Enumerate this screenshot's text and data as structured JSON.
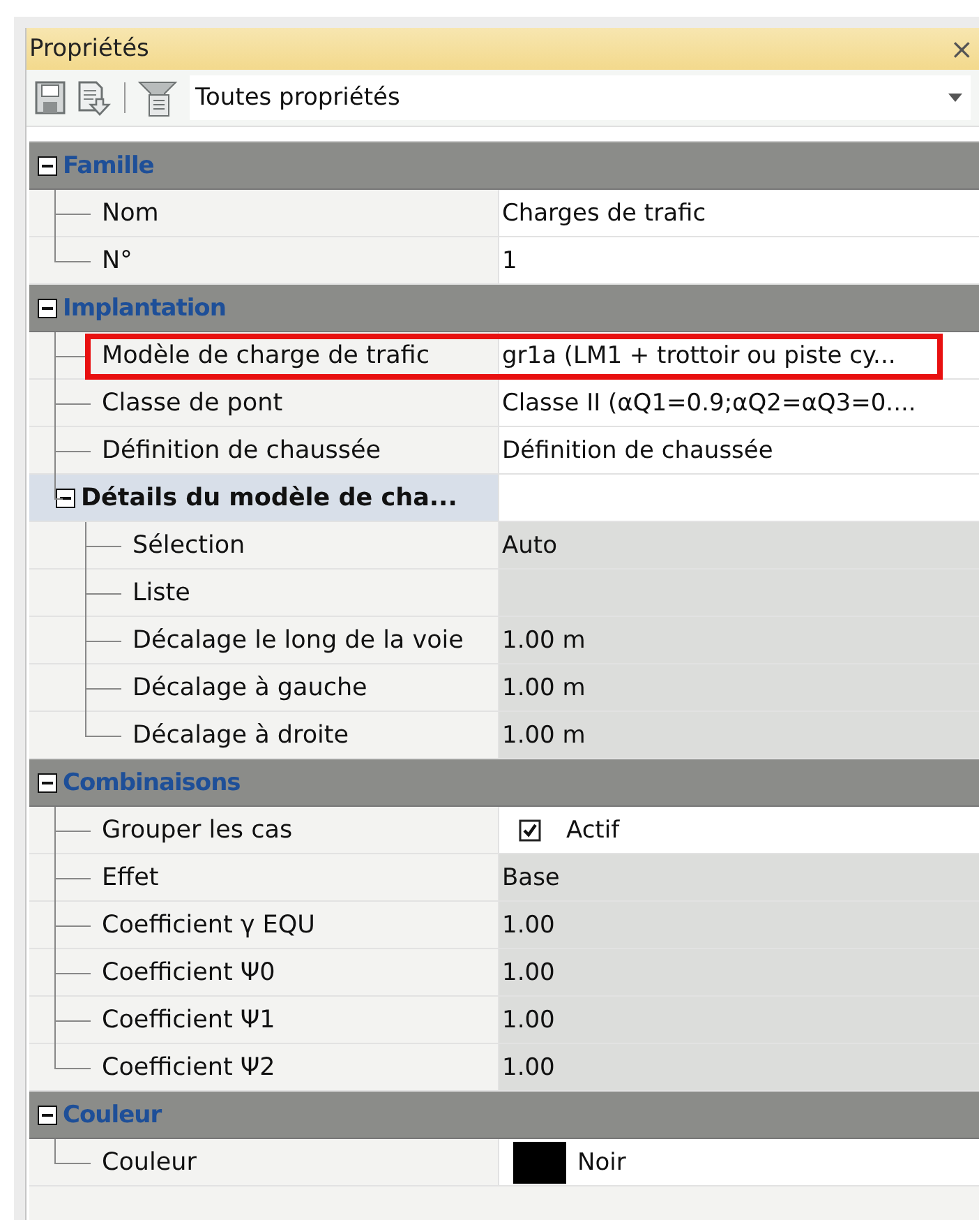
{
  "panel": {
    "title": "Propriétés",
    "close": "×"
  },
  "toolbar": {
    "filter": "Toutes propriétés"
  },
  "categories": [
    {
      "title": "Famille",
      "expanded": true,
      "rows": [
        {
          "label": "Nom",
          "value": "Charges de trafic",
          "kind": "text",
          "readonly": false,
          "highlighted": false
        },
        {
          "label": "N°",
          "value": "1",
          "kind": "text",
          "readonly": false,
          "highlighted": false
        }
      ]
    },
    {
      "title": "Implantation",
      "expanded": true,
      "rows": [
        {
          "label": "Modèle de charge de trafic",
          "value": "gr1a (LM1 + trottoir ou piste cy...",
          "kind": "text",
          "readonly": false,
          "highlighted": true
        },
        {
          "label": "Classe de pont",
          "value": "Classe II (αQ1=0.9;αQ2=αQ3=0....",
          "kind": "text",
          "readonly": false,
          "highlighted": false
        },
        {
          "label": "Définition de chaussée",
          "value": "Définition de chaussée",
          "kind": "text",
          "readonly": false,
          "highlighted": false
        },
        {
          "label": "Détails du modèle de cha...",
          "kind": "group",
          "expanded": true,
          "children": [
            {
              "label": "Sélection",
              "value": "Auto",
              "kind": "text",
              "readonly": true,
              "highlighted": false
            },
            {
              "label": "Liste",
              "kind": "text",
              "readonly": true,
              "highlighted": false
            },
            {
              "label": "Décalage le long de la voie",
              "value": "1.00 m",
              "kind": "text",
              "readonly": true,
              "highlighted": false
            },
            {
              "label": "Décalage à gauche",
              "value": "1.00 m",
              "kind": "text",
              "readonly": true,
              "highlighted": false
            },
            {
              "label": "Décalage à droite",
              "value": "1.00 m",
              "kind": "text",
              "readonly": true,
              "highlighted": false
            }
          ]
        }
      ]
    },
    {
      "title": "Combinaisons",
      "expanded": true,
      "rows": [
        {
          "label": "Grouper les cas",
          "value": "Actif",
          "kind": "check",
          "checked": true,
          "readonly": false,
          "highlighted": false
        },
        {
          "label": "Effet",
          "value": "Base",
          "kind": "text",
          "readonly": true,
          "highlighted": false
        },
        {
          "label": "Coefficient γ EQU",
          "value": "1.00",
          "kind": "text",
          "readonly": true,
          "highlighted": false
        },
        {
          "label": "Coefficient Ψ0",
          "value": "1.00",
          "kind": "text",
          "readonly": true,
          "highlighted": false
        },
        {
          "label": "Coefficient Ψ1",
          "value": "1.00",
          "kind": "text",
          "readonly": true,
          "highlighted": false
        },
        {
          "label": "Coefficient Ψ2",
          "value": "1.00",
          "kind": "text",
          "readonly": true,
          "highlighted": false
        }
      ]
    },
    {
      "title": "Couleur",
      "expanded": true,
      "rows": [
        {
          "label": "Couleur",
          "value": "Noir",
          "kind": "color",
          "color": "#000000",
          "readonly": false,
          "highlighted": false
        }
      ]
    }
  ]
}
